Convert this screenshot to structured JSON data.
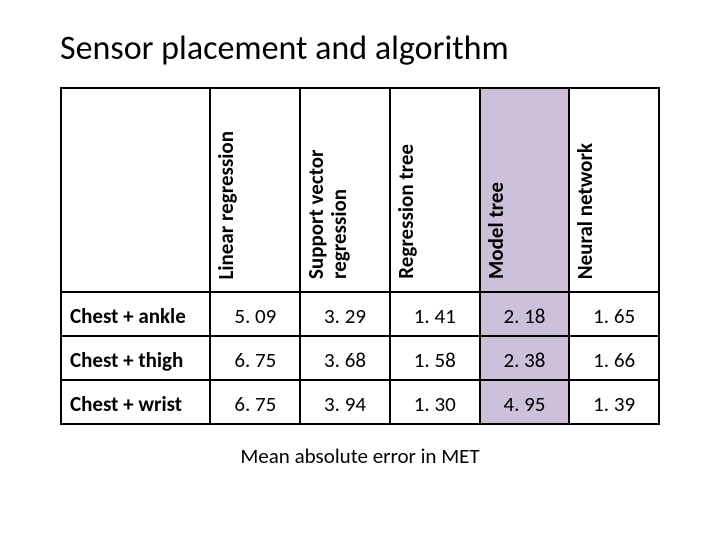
{
  "title": "Sensor placement and algorithm",
  "columns": {
    "blank": "",
    "c0": "Linear regression",
    "c1": "Support vector regression",
    "c2": "Regression tree",
    "c3": "Model tree",
    "c4": "Neural network"
  },
  "rows": [
    {
      "label": "Chest + ankle",
      "v0": "5. 09",
      "v1": "3. 29",
      "v2": "1. 41",
      "v3": "2. 18",
      "v4": "1. 65"
    },
    {
      "label": "Chest + thigh",
      "v0": "6. 75",
      "v1": "3. 68",
      "v2": "1. 58",
      "v3": "2. 38",
      "v4": "1. 66"
    },
    {
      "label": "Chest + wrist",
      "v0": "6. 75",
      "v1": "3. 94",
      "v2": "1. 30",
      "v3": "4. 95",
      "v4": "1. 39"
    }
  ],
  "caption": "Mean absolute error in MET",
  "chart_data": {
    "type": "table",
    "title": "Sensor placement and algorithm",
    "columns": [
      "Linear regression",
      "Support vector regression",
      "Regression tree",
      "Model tree",
      "Neural network"
    ],
    "rows": [
      "Chest + ankle",
      "Chest + thigh",
      "Chest + wrist"
    ],
    "values": [
      [
        5.09,
        3.29,
        1.41,
        2.18,
        1.65
      ],
      [
        6.75,
        3.68,
        1.58,
        2.38,
        1.66
      ],
      [
        6.75,
        3.94,
        1.3,
        4.95,
        1.39
      ]
    ],
    "highlight_column": "Model tree",
    "caption": "Mean absolute error in MET"
  }
}
